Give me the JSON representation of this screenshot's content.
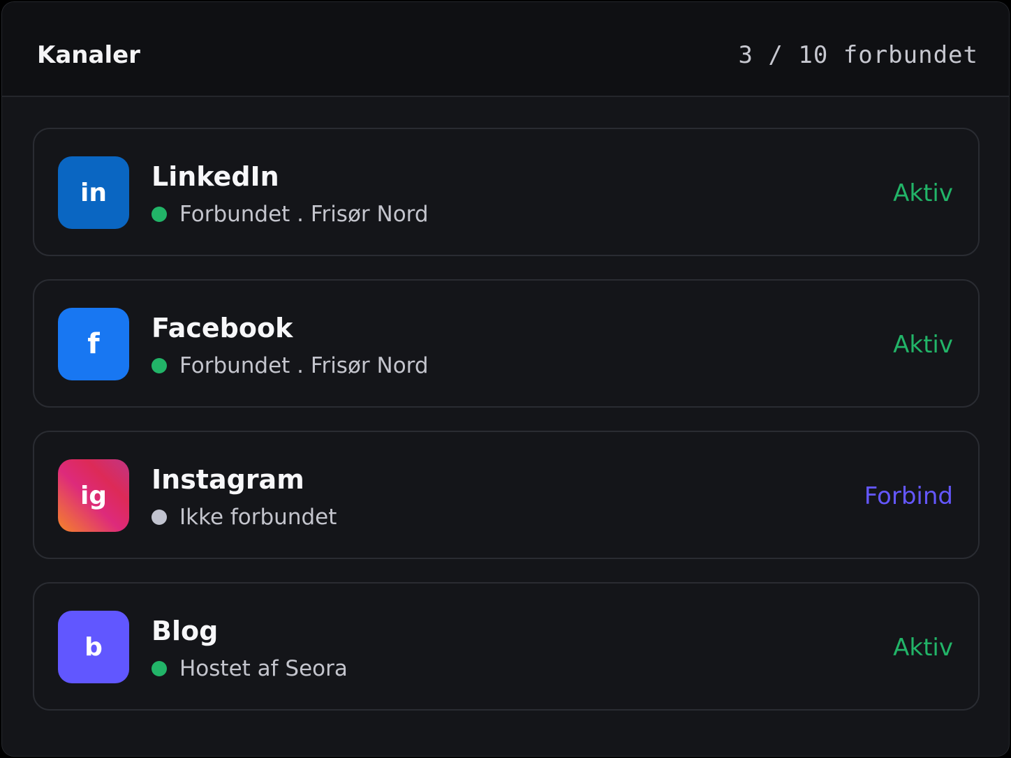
{
  "header": {
    "title": "Kanaler",
    "count": "3 / 10 forbundet"
  },
  "colors": {
    "panel_bg": "#141519",
    "active_green": "#22b468",
    "connect_purple": "#6457ff",
    "inactive_gray": "#c1c3cf"
  },
  "channels": [
    {
      "name": "LinkedIn",
      "logo_text": "in",
      "logo_icon": "linkedin-icon",
      "logo_color": "#0a66c2",
      "status": "Forbundet . Frisør Nord",
      "status_dot_color": "#22b468",
      "action": "Aktiv",
      "action_color": "#22b468"
    },
    {
      "name": "Facebook",
      "logo_text": "f",
      "logo_icon": "facebook-icon",
      "logo_color": "#1877f2",
      "status": "Forbundet . Frisør Nord",
      "status_dot_color": "#22b468",
      "action": "Aktiv",
      "action_color": "#22b468"
    },
    {
      "name": "Instagram",
      "logo_text": "ig",
      "logo_icon": "instagram-icon",
      "logo_color": "#e1306c",
      "status": "Ikke forbundet",
      "status_dot_color": "#c1c3cf",
      "action": "Forbind",
      "action_color": "#6457ff"
    },
    {
      "name": "Blog",
      "logo_text": "b",
      "logo_icon": "blog-icon",
      "logo_color": "#6157ff",
      "status": "Hostet af Seora",
      "status_dot_color": "#22b468",
      "action": "Aktiv",
      "action_color": "#22b468"
    }
  ]
}
